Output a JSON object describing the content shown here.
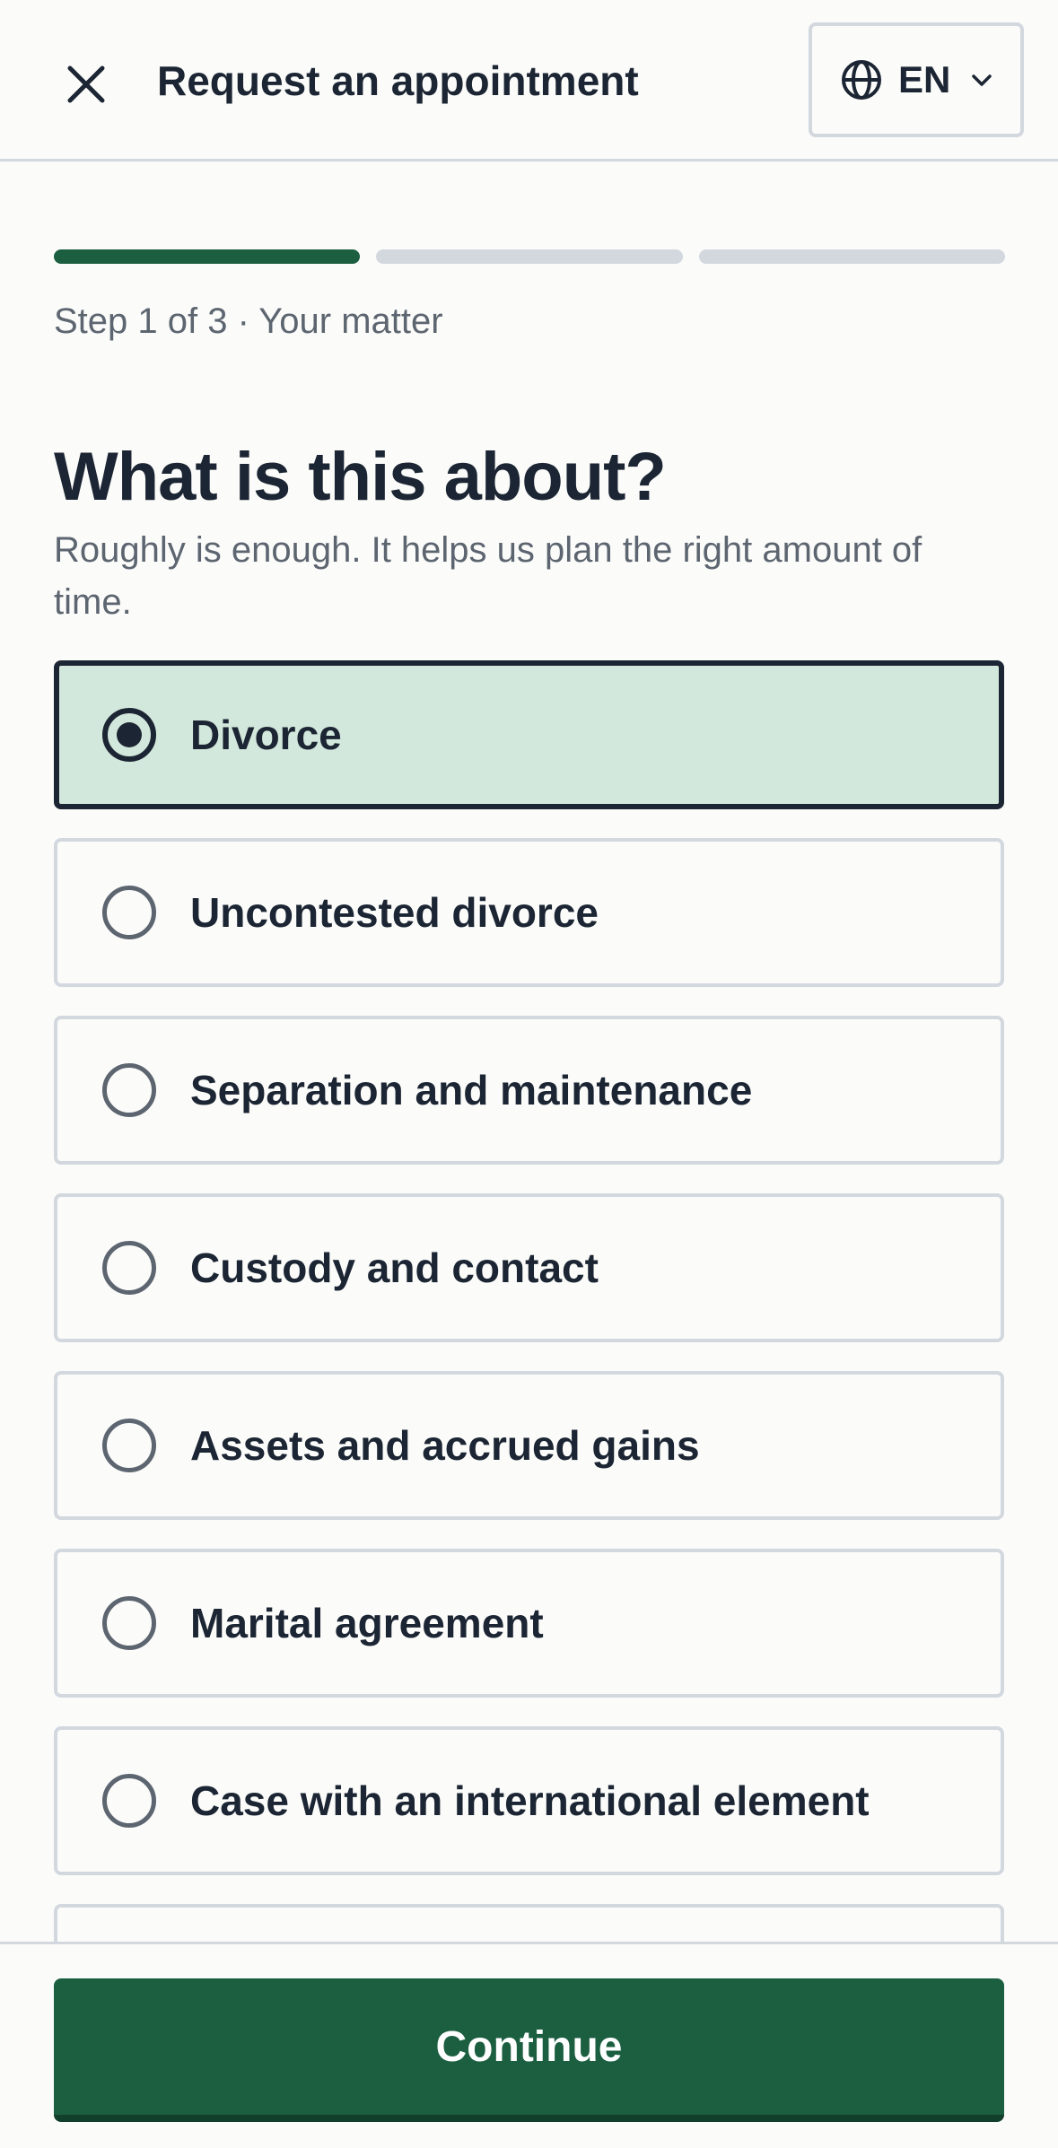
{
  "header": {
    "title": "Request an appointment",
    "language": "EN",
    "icons": {
      "close": "close-icon",
      "language": "globe-icon",
      "dropdown": "chevron-down-icon"
    }
  },
  "progress": {
    "total_steps": 3,
    "current_step": 1,
    "label": "Step 1 of 3 · Your matter"
  },
  "question": {
    "title": "What is this about?",
    "helper": "Roughly is enough. It helps us plan the right amount of time."
  },
  "options": [
    {
      "label": "Divorce",
      "selected": true
    },
    {
      "label": "Uncontested divorce",
      "selected": false
    },
    {
      "label": "Separation and maintenance",
      "selected": false
    },
    {
      "label": "Custody and contact",
      "selected": false
    },
    {
      "label": "Assets and accrued gains",
      "selected": false
    },
    {
      "label": "Marital agreement",
      "selected": false
    },
    {
      "label": "Case with an international element",
      "selected": false
    },
    {
      "label": "",
      "selected": false
    }
  ],
  "footer": {
    "continue_label": "Continue"
  },
  "colors": {
    "accent": "#1b5e40",
    "selected_background": "#d3e8dc",
    "border": "#d3d8df",
    "text": "#1c2533",
    "muted_text": "#5d6570"
  }
}
